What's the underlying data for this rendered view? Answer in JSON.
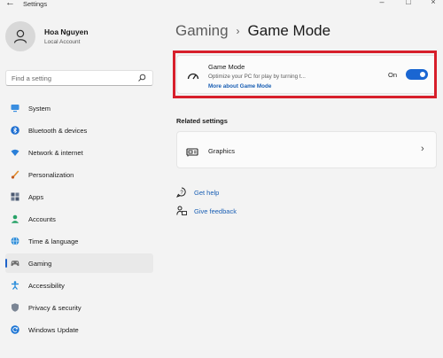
{
  "window": {
    "back_glyph": "←",
    "title": "Settings",
    "controls": [
      "–",
      "□",
      "×"
    ]
  },
  "profile": {
    "name": "Hoa Nguyen",
    "account_type": "Local Account"
  },
  "search": {
    "placeholder": "Find a setting"
  },
  "sidebar": {
    "items": [
      {
        "label": "System",
        "icon": "monitor-icon"
      },
      {
        "label": "Bluetooth & devices",
        "icon": "bluetooth-icon"
      },
      {
        "label": "Network & internet",
        "icon": "wifi-icon"
      },
      {
        "label": "Personalization",
        "icon": "brush-icon"
      },
      {
        "label": "Apps",
        "icon": "apps-icon"
      },
      {
        "label": "Accounts",
        "icon": "person-icon"
      },
      {
        "label": "Time & language",
        "icon": "globe-icon"
      },
      {
        "label": "Gaming",
        "icon": "controller-icon"
      },
      {
        "label": "Accessibility",
        "icon": "accessibility-icon"
      },
      {
        "label": "Privacy & security",
        "icon": "shield-icon"
      },
      {
        "label": "Windows Update",
        "icon": "update-icon"
      }
    ],
    "active_index": 7
  },
  "breadcrumb": {
    "parent": "Gaming",
    "separator": "›",
    "current": "Game Mode"
  },
  "game_mode": {
    "title": "Game Mode",
    "description": "Optimize your PC for play by turning t...",
    "link": "More about Game Mode",
    "toggle_state": "On",
    "toggle_on": true
  },
  "related": {
    "title": "Related settings",
    "graphics_label": "Graphics",
    "chevron": "›"
  },
  "help": {
    "get_help": "Get help",
    "give_feedback": "Give feedback"
  },
  "colors": {
    "accent": "#1a66d2",
    "highlight_border": "#d71f2b",
    "link": "#1a5fb4"
  }
}
